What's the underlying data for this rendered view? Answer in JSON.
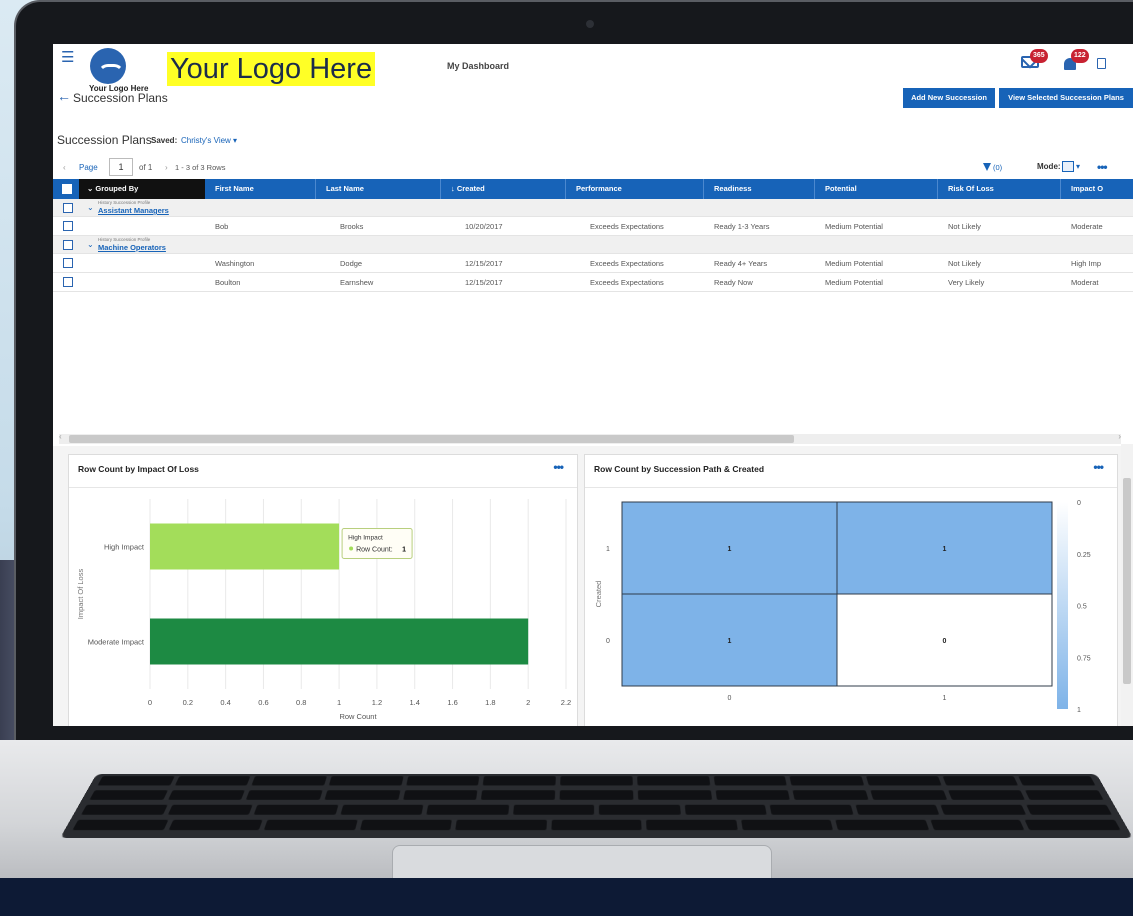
{
  "header": {
    "logo_small_text": "Your Logo Here",
    "logo_banner_text": "Your Logo Here",
    "nav_title": "My Dashboard",
    "page_title": "Succession Plans",
    "mail_badge": "365",
    "bell_badge": "122",
    "add_button": "Add New Succession Plans",
    "view_button": "View Selected Succession Plans"
  },
  "view": {
    "title": "Succession Plans",
    "saved_label": "Saved:",
    "saved_value": "Christy's View ▾"
  },
  "pager": {
    "prev": "‹",
    "page_label": "Page",
    "page_value": "1",
    "of_label": "of 1",
    "next": "›",
    "rows_label": "1 - 3 of 3 Rows",
    "filter_count": "(0)",
    "mode_label": "Mode:"
  },
  "grid": {
    "grouped_by": "Grouped By",
    "columns": [
      "First Name",
      "Last Name",
      "↓ Created",
      "Performance",
      "Readiness",
      "Potential",
      "Risk Of Loss",
      "Impact O"
    ],
    "groups": [
      {
        "sub": "History Succession Profile",
        "name": "Assistant Managers",
        "rows": [
          [
            "Bob",
            "Brooks",
            "10/20/2017",
            "Exceeds Expectations",
            "Ready 1-3 Years",
            "Medium Potential",
            "Not Likely",
            "Moderate"
          ]
        ]
      },
      {
        "sub": "History Succession Profile",
        "name": "Machine Operators",
        "rows": [
          [
            "Washington",
            "Dodge",
            "12/15/2017",
            "Exceeds Expectations",
            "Ready 4+ Years",
            "Medium Potential",
            "Not Likely",
            "High Imp"
          ],
          [
            "Boulton",
            "Earnshew",
            "12/15/2017",
            "Exceeds Expectations",
            "Ready Now",
            "Medium Potential",
            "Very Likely",
            "Moderat"
          ]
        ]
      }
    ]
  },
  "colors": {
    "primary": "#1763b8",
    "bar_high": "#a3dd5a",
    "bar_moderate": "#1d8a43",
    "heat_cell": "#7eb3e8",
    "badge": "#c82232",
    "logo_yellow": "#ffff26"
  },
  "chart_data": [
    {
      "type": "bar",
      "orientation": "horizontal",
      "title": "Row Count by Impact Of Loss",
      "xlabel": "Row Count",
      "ylabel": "Impact Of Loss",
      "categories": [
        "High Impact",
        "Moderate Impact"
      ],
      "values": [
        1,
        2
      ],
      "xlim": [
        0,
        2.2
      ],
      "ticks": [
        "0",
        "0.2",
        "0.4",
        "0.6",
        "0.8",
        "1",
        "1.2",
        "1.4",
        "1.6",
        "1.8",
        "2",
        "2.2"
      ],
      "tooltip": {
        "title": "High Impact",
        "label": "Row Count:",
        "value": "1"
      }
    },
    {
      "type": "heatmap",
      "title": "Row Count by Succession Path & Created",
      "ylabel": "Created",
      "x_categories": [
        "0",
        "1"
      ],
      "y_categories": [
        "1",
        "0"
      ],
      "values": [
        [
          "1",
          "1"
        ],
        [
          "1",
          "0"
        ]
      ],
      "scale_ticks": [
        "0",
        "0.25",
        "0.5",
        "0.75",
        "1"
      ]
    }
  ]
}
